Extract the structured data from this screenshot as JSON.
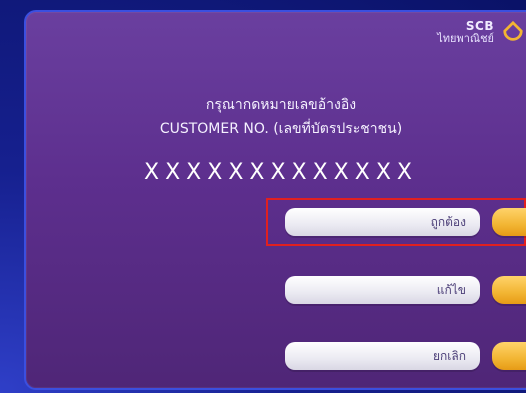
{
  "brand": {
    "name": "SCB",
    "thai_name": "ไทยพาณิชย์",
    "logo_color": "#f2b533"
  },
  "prompt": {
    "line_thai": "กรุณากดหมายเลขอ้างอิง",
    "line_en": "CUSTOMER NO. (เลขที่บัตรประชาชน)"
  },
  "masked_value": "XXXXXXXXXXXXX",
  "buttons": [
    {
      "label": "ถูกต้อง",
      "selected": true
    },
    {
      "label": "แก้ไข",
      "selected": false
    },
    {
      "label": "ยกเลิก",
      "selected": false
    }
  ],
  "colors": {
    "screen": "#5d2f8e",
    "button": "#efeef5",
    "tab": "#f2b533",
    "highlight": "#e02020"
  }
}
